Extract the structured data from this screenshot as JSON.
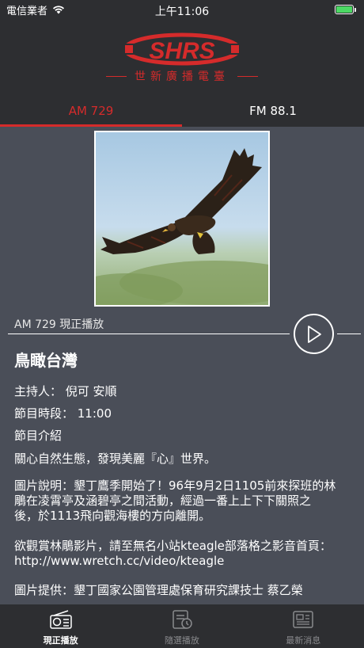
{
  "status_bar": {
    "carrier": "電信業者",
    "time": "上午11:06"
  },
  "header": {
    "logo_text": "SHRS",
    "station_name": "世新廣播電臺"
  },
  "tabs": [
    {
      "label": "AM 729",
      "active": true
    },
    {
      "label": "FM 88.1",
      "active": false
    }
  ],
  "now_playing": {
    "label": "AM 729 現正播放"
  },
  "program": {
    "title": "鳥瞰台灣",
    "host": "主持人： 倪可 安順",
    "timeslot": "節目時段： 11:00",
    "intro_heading": "節目介紹",
    "intro": "關心自然生態，發現美麗『心』世界。",
    "photo_caption_lines": [
      "圖片說明：墾丁鷹季開始了！96年9月2日1105前來探班的林",
      "鵰在凌霄亭及涵碧亭之間活動，經過一番上上下下關照之",
      "後，於1113飛向觀海樓的方向離開。"
    ],
    "link_lines": [
      "欲觀賞林鵰影片，請至無名小站kteagle部落格之影音首頁：",
      "http://www.wretch.cc/video/kteagle"
    ],
    "credit": "圖片提供：墾丁國家公園管理處保育研究課技士  蔡乙榮"
  },
  "tabbar": [
    {
      "label": "現正播放",
      "icon": "radio-icon",
      "active": true
    },
    {
      "label": "隨選播放",
      "icon": "schedule-icon",
      "active": false
    },
    {
      "label": "最新消息",
      "icon": "news-icon",
      "active": false
    }
  ],
  "colors": {
    "accent": "#d52b2b",
    "background": "#2d2e31",
    "content_bg": "#4a4e58"
  }
}
